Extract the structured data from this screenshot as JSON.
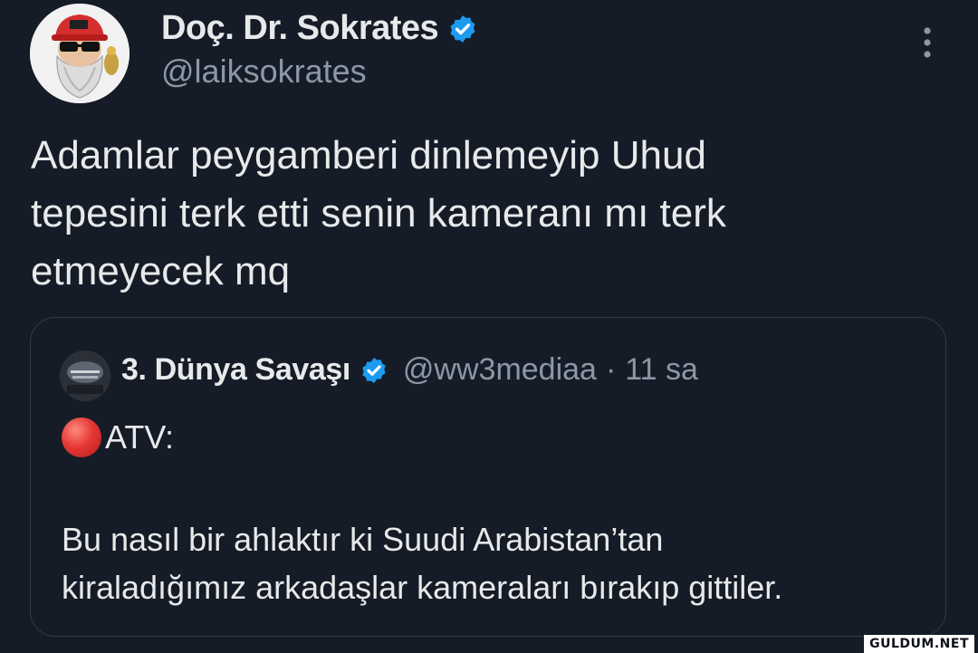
{
  "author": {
    "display_name": "Doç. Dr. Sokrates",
    "handle": "@laiksokrates",
    "verified": true,
    "avatar_icon": "avatar-bearded-man-red-cap"
  },
  "more_icon": "vertical-ellipsis-icon",
  "tweet_text": "Adamlar peygamberi dinlemeyip Uhud\ntepesini terk etti senin kameranı mı terk\netmeyecek mq",
  "quoted_tweet": {
    "display_name": "3. Dünya Savaşı",
    "handle": "@ww3mediaa",
    "separator": "·",
    "time": "11 sa",
    "verified": true,
    "avatar_icon": "avatar-world-war-logo",
    "line1_icon": "red-circle-emoji",
    "line1": "ATV:",
    "body": "Bu nasıl bir ahlaktır ki Suudi Arabistan’tan\nkiraladığımız arkadaşlar kameraları bırakıp gittiler."
  },
  "watermark": "GULDUM.NET",
  "colors": {
    "background": "#151c27",
    "text": "#e7e9ea",
    "muted": "#8b98a5",
    "verified_blue": "#1d9bf0",
    "border": "#2f3b4a"
  }
}
